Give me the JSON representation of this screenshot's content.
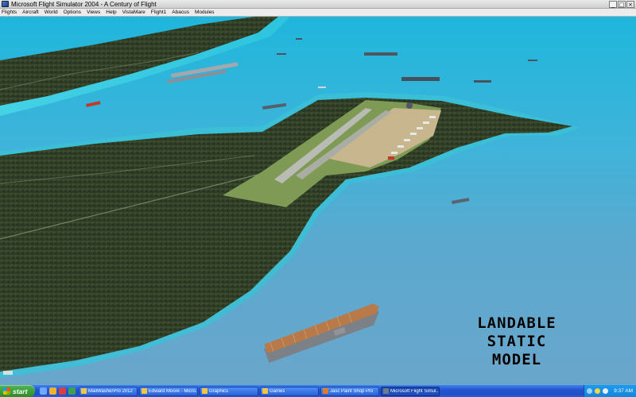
{
  "window": {
    "title": "Microsoft Flight Simulator 2004 - A Century of Flight",
    "buttons": [
      "_",
      "□",
      "×"
    ]
  },
  "menu": [
    "Flights",
    "Aircraft",
    "World",
    "Options",
    "Views",
    "Help",
    "VistaMare",
    "Flight1",
    "Abacus",
    "Modules"
  ],
  "scene": {
    "caption_lines": [
      "LANDABLE",
      "STATIC",
      "MODEL"
    ]
  },
  "taskbar": {
    "start_label": "start",
    "tasks": [
      {
        "label": "MailWasherPro 2012",
        "color": "#f4c542"
      },
      {
        "label": "Edward Moore - Micro...",
        "color": "#f4c542"
      },
      {
        "label": "Graphics",
        "color": "#f4c542"
      },
      {
        "label": "Games",
        "color": "#f4c542"
      },
      {
        "label": "Jasc Paint Shop Pro",
        "color": "#e07b2a"
      },
      {
        "label": "Microsoft Flight Simul...",
        "color": "#6b7c8f"
      }
    ],
    "clock": "9:37 AM"
  },
  "icons": [
    "app-icon",
    "windows-flag-icon",
    "quick-launch-icon",
    "tray-icon"
  ]
}
